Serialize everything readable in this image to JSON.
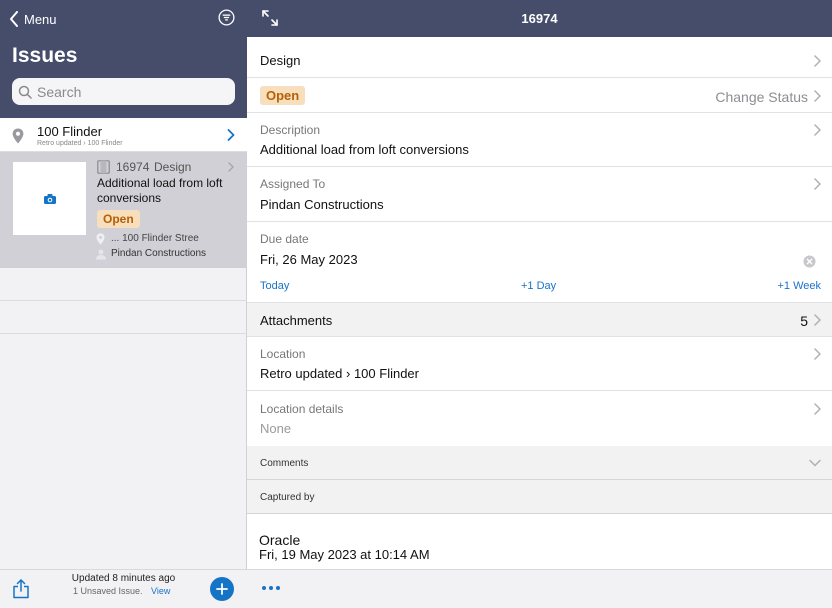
{
  "left": {
    "menu_label": "Menu",
    "title": "Issues",
    "search_placeholder": "Search",
    "group": {
      "title": "100 Flinder",
      "subtitle": "Retro updated › 100 Flinder"
    },
    "issue": {
      "id": "16974",
      "category": "Design",
      "description": "Additional load from loft conversions",
      "status": "Open",
      "location": "... 100 Flinder Stree",
      "assignee": "Pindan Constructions"
    },
    "footer": {
      "updated": "Updated 8 minutes ago",
      "unsaved": "1 Unsaved Issue.",
      "view_label": "View"
    }
  },
  "right": {
    "title": "16974",
    "category": "Design",
    "status": "Open",
    "change_status_label": "Change Status",
    "description_label": "Description",
    "description_value": "Additional load from loft conversions",
    "assigned_label": "Assigned To",
    "assigned_value": "Pindan Constructions",
    "due_label": "Due date",
    "due_value": "Fri, 26 May 2023",
    "due_today": "Today",
    "due_plus_day": "+1 Day",
    "due_plus_week": "+1 Week",
    "attachments_label": "Attachments",
    "attachments_count": "5",
    "location_label": "Location",
    "location_value": "Retro updated › 100 Flinder",
    "location_details_label": "Location details",
    "location_details_value": "None",
    "comments_label": "Comments",
    "captured_label": "Captured by",
    "captured_name": "Oracle",
    "captured_date": "Fri, 19 May 2023 at 10:14 AM"
  },
  "colors": {
    "header": "#454d6b",
    "accent": "#1574c6",
    "status_bg": "#f7dfbe",
    "status_text": "#b65f05"
  }
}
